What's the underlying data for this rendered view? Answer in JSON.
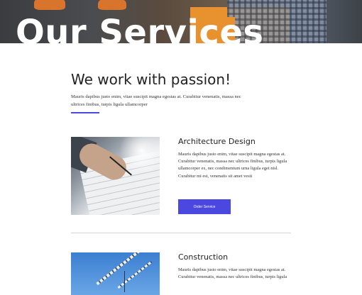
{
  "hero": {
    "title": "Our Services"
  },
  "intro": {
    "heading": "We work with passion!",
    "text": "Mauris dapibus justo enim, vitae suscipit magna egestas at. Curabitur venenatis, massa nec ultrices finibus, turpis ligula ullamcorper"
  },
  "services": [
    {
      "title": "Architecture Design",
      "description": "Mauris dapibus justo enim, vitae suscipit magna egestas at. Curabitur venenatis, massa nec ultrices finibus, turpis ligula ullamcorper ex, nec condimentum urna ligula eget nisl. Curabitur mi est, venenatis sit amet vesti",
      "button_label": "Order Service"
    },
    {
      "title": "Construction",
      "description": "Mauris dapibus justo enim, vitae suscipit magna egestas at. Curabitur venenatis, massa nec ultrices finibus, turpis ligula"
    }
  ],
  "colors": {
    "accent": "#4a48e0",
    "heading": "#222222",
    "divider": "#d4d4d4"
  }
}
